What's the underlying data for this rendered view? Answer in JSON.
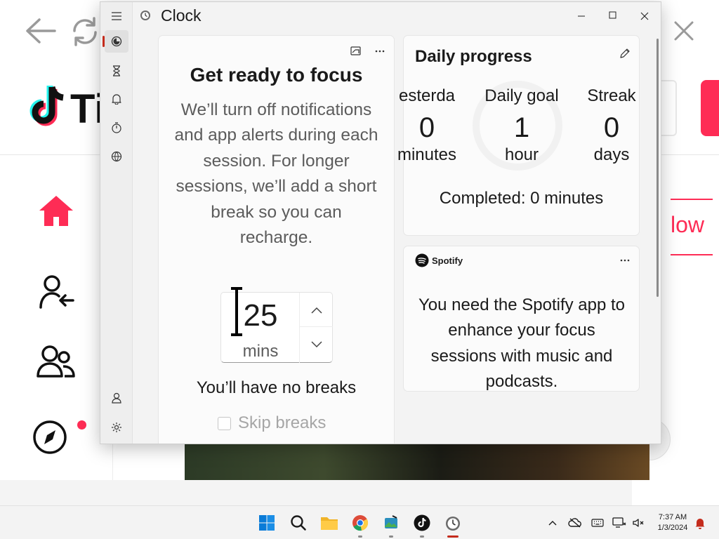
{
  "background": {
    "brand_wordmark": "Ti",
    "follow_label": "low"
  },
  "window": {
    "app_title": "Clock"
  },
  "rail": {
    "items": [
      "Focus sessions",
      "Timer",
      "Alarm",
      "Stopwatch",
      "World clock"
    ],
    "footer": [
      "Account",
      "Settings"
    ]
  },
  "focus": {
    "title": "Get ready to focus",
    "description": "We’ll turn off notifications and app alerts during each session. For longer sessions, we’ll add a short break so you can recharge.",
    "duration_value": "25",
    "duration_unit": "mins",
    "breaks_text": "You’ll have no breaks",
    "skip_breaks_label": "Skip breaks",
    "skip_breaks_checked": false
  },
  "progress": {
    "title": "Daily progress",
    "yesterday_label": "esterda",
    "yesterday_value": "0",
    "yesterday_unit": "minutes",
    "goal_label": "Daily goal",
    "goal_value": "1",
    "goal_unit": "hour",
    "streak_label": "Streak",
    "streak_value": "0",
    "streak_unit": "days",
    "completed_text": "Completed: 0 minutes"
  },
  "spotify": {
    "brand": "Spotify",
    "message": "You need the Spotify app to enhance your focus sessions with music and podcasts."
  },
  "taskbar": {
    "time": "7:37 AM",
    "date": "1/3/2024",
    "apps": [
      "start-icon",
      "search-icon",
      "file-explorer-icon",
      "chrome-icon",
      "photos-icon",
      "tiktok-icon",
      "clock-icon"
    ]
  },
  "colors": {
    "tiktok_red": "#fe2c55",
    "accent": "#c42b1c"
  }
}
